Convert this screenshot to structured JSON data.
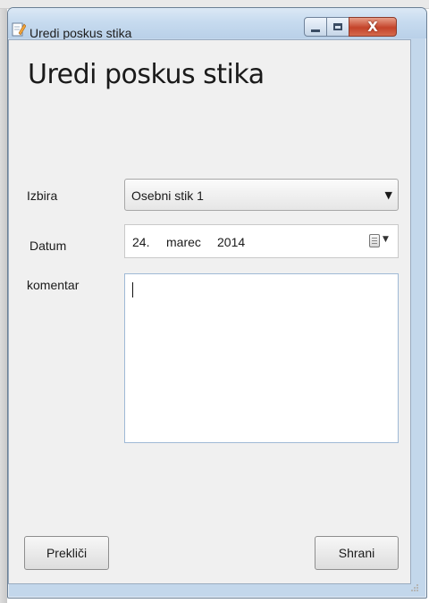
{
  "window": {
    "title": "Uredi poskus stika",
    "close_glyph": "X"
  },
  "form": {
    "heading": "Uredi poskus stika",
    "selection": {
      "label": "Izbira",
      "value": "Osebni stik 1"
    },
    "date": {
      "label": "Datum",
      "day": "24.",
      "month": "marec",
      "year": "2014"
    },
    "comment": {
      "label": "komentar",
      "value": ""
    }
  },
  "buttons": {
    "cancel": "Prekliči",
    "save": "Shrani"
  },
  "icons": {
    "title": "edit-document-icon",
    "minimize": "minimize-icon",
    "maximize": "maximize-icon",
    "close": "close-icon",
    "dropdown": "chevron-down-icon",
    "calendar": "calendar-icon",
    "resize": "resize-grip-icon"
  },
  "colors": {
    "titlebar": "#c7dbef",
    "close_button": "#c4432a",
    "client_bg": "#f0f0f0",
    "textarea_border": "#9fb9d6"
  }
}
